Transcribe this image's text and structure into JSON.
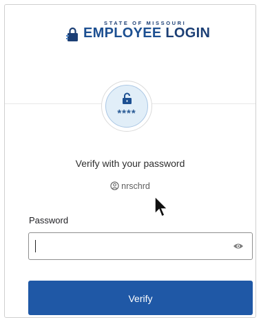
{
  "logo": {
    "top_line": "STATE OF MISSOURI",
    "employee": "EMPLOYEE",
    "login": "LOGIN"
  },
  "badge": {
    "mask": "****",
    "icon": "unlocked-padlock-icon"
  },
  "heading": "Verify with your password",
  "user": {
    "name": "nrschrd",
    "icon": "user-circle-icon"
  },
  "password_field": {
    "label": "Password",
    "value": "",
    "toggle_icon": "eye-icon"
  },
  "verify_button": "Verify",
  "colors": {
    "primary": "#1f58a6",
    "brand_dark": "#1c3f75",
    "badge_bg": "#e1eef8"
  }
}
